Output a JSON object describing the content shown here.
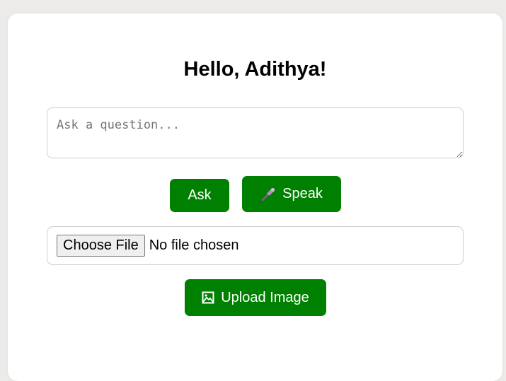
{
  "greeting": "Hello, Adithya!",
  "question": {
    "placeholder": "Ask a question...",
    "value": ""
  },
  "buttons": {
    "ask_label": "Ask",
    "speak_label": "Speak",
    "speak_icon": "microphone-icon",
    "upload_label": "Upload Image",
    "upload_icon": "image-icon"
  },
  "file_input": {
    "button_label": "Choose File",
    "status": "No file chosen"
  },
  "colors": {
    "accent": "#008000",
    "page_background": "#ecebea",
    "card_background": "#ffffff",
    "border": "#cfcfcf"
  }
}
